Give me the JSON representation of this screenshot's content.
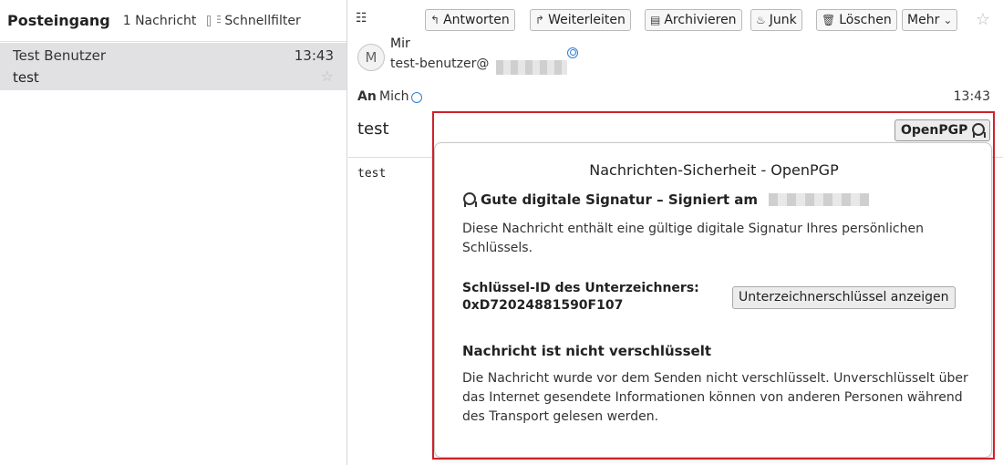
{
  "folder_pane": {
    "title": "Posteingang",
    "message_count": "1 Nachricht",
    "quick_filter_label": "Schnellfilter"
  },
  "message_list": [
    {
      "sender": "Test Benutzer",
      "time": "13:43",
      "subject": "test"
    }
  ],
  "toolbar": {
    "reply": "Antworten",
    "forward": "Weiterleiten",
    "archive": "Archivieren",
    "junk": "Junk",
    "delete": "Löschen",
    "more": "Mehr"
  },
  "header": {
    "avatar_letter": "M",
    "from_name": "Mir",
    "from_address": "test-benutzer@",
    "to_label": "An",
    "to_value": "Mich",
    "time": "13:43",
    "subject": "test"
  },
  "body": {
    "text": "test"
  },
  "security": {
    "button_label": "OpenPGP",
    "popup_title": "Nachrichten-Sicherheit - OpenPGP",
    "signature_status": "Gute digitale Signatur – Signiert am",
    "signature_description": "Diese Nachricht enthält eine gültige digitale Signatur Ihres persönlichen Schlüssels.",
    "signer_key_label": "Schlüssel-ID des Unterzeichners:",
    "signer_key_id": "0xD72024881590F107",
    "view_key_button": "Unterzeichnerschlüssel anzeigen",
    "encryption_status": "Nachricht ist nicht verschlüsselt",
    "encryption_description": "Die Nachricht wurde vor dem Senden nicht verschlüsselt. Unverschlüsselt über das Internet gesendete Informationen können von anderen Personen während des Transport gelesen werden."
  },
  "colors": {
    "highlight": "#d0202a",
    "selected_row": "#e1e1e3",
    "contact_icon": "#2f80d6"
  }
}
